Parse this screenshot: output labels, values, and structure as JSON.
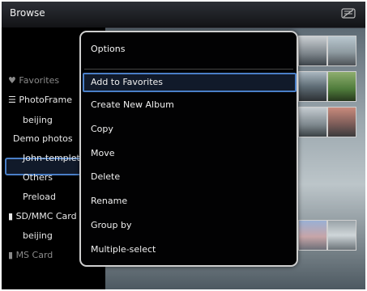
{
  "header": {
    "title": "Browse",
    "card_icon": "memory-card-icon"
  },
  "sidebar": {
    "favorites": {
      "label": "Favorites",
      "icon": "heart-icon"
    },
    "photoframe": {
      "label": "PhotoFrame",
      "icon": "list-icon"
    },
    "albums": [
      "beijing",
      "Demo photos",
      "John-templete",
      "Others",
      "Preload"
    ],
    "selected_album": "Demo photos",
    "sdmmc": {
      "label": "SD/MMC Card",
      "icon": "card-icon"
    },
    "sdmmc_albums": [
      "beijing"
    ],
    "ms": {
      "label": "MS Card",
      "icon": "card-icon"
    }
  },
  "options_menu": {
    "title": "Options",
    "items": [
      "Add to Favorites",
      "Create New Album",
      "Copy",
      "Move",
      "Delete",
      "Rename",
      "Group by",
      "Multiple-select"
    ],
    "selected": "Add to Favorites"
  },
  "colors": {
    "selection": "#4a7fc7",
    "background": "#06070a"
  }
}
